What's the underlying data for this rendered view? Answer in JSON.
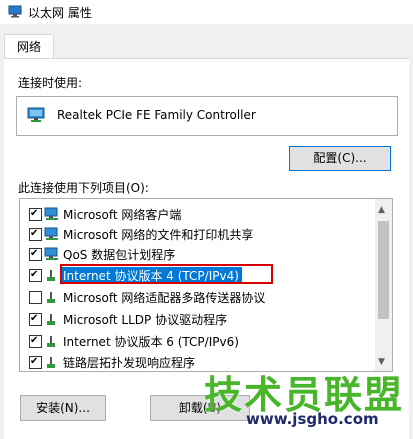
{
  "window": {
    "title": "以太网 属性"
  },
  "tabs": [
    {
      "label": "网络"
    }
  ],
  "connect_using": {
    "label": "连接时使用:",
    "adapter": "Realtek PCIe FE Family Controller",
    "configure_button": "配置(C)..."
  },
  "items_section": {
    "label": "此连接使用下列项目(O):",
    "items": [
      {
        "label": "Microsoft 网络客户端",
        "checked": true,
        "icon": "network-client-icon"
      },
      {
        "label": "Microsoft 网络的文件和打印机共享",
        "checked": true,
        "icon": "file-printer-sharing-icon"
      },
      {
        "label": "QoS 数据包计划程序",
        "checked": true,
        "icon": "qos-icon"
      },
      {
        "label": "Internet 协议版本 4 (TCP/IPv4)",
        "checked": true,
        "icon": "protocol-icon",
        "selected": true
      },
      {
        "label": "Microsoft 网络适配器多路传送器协议",
        "checked": false,
        "icon": "protocol-icon"
      },
      {
        "label": "Microsoft LLDP 协议驱动程序",
        "checked": true,
        "icon": "protocol-icon"
      },
      {
        "label": "Internet 协议版本 6 (TCP/IPv6)",
        "checked": true,
        "icon": "protocol-icon"
      },
      {
        "label": "链路层拓扑发现响应程序",
        "checked": true,
        "icon": "protocol-icon"
      }
    ]
  },
  "buttons": {
    "install": "安装(N)...",
    "uninstall": "卸载(U)"
  },
  "watermark": {
    "text": "技术员联盟",
    "url": "www.jsgho.com"
  },
  "colors": {
    "selection": "#0078d7",
    "highlight_box": "#d40000",
    "watermark_green": "#48b52a",
    "watermark_navy": "#1f2a6b"
  }
}
